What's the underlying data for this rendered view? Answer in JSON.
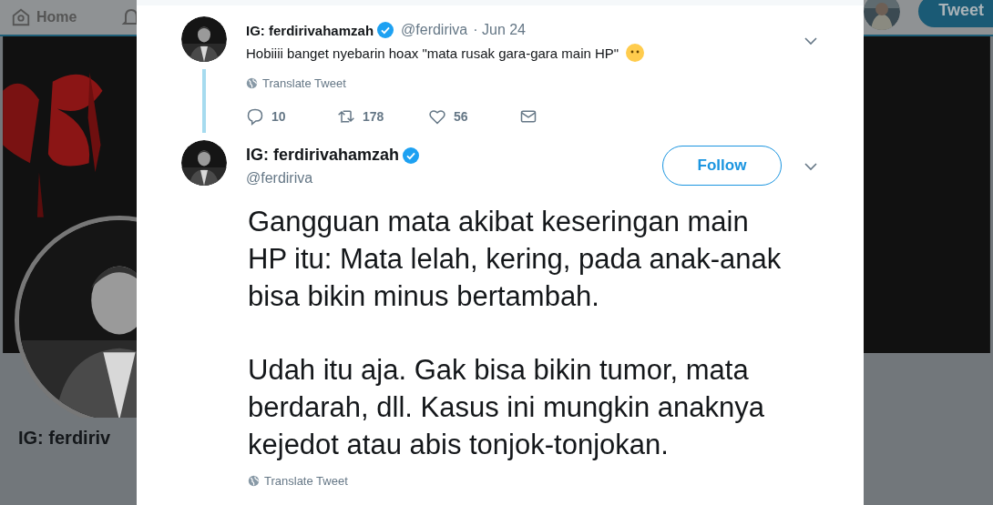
{
  "background_page": {
    "nav": {
      "home_label": "Home",
      "tweet_button": "Tweet"
    },
    "profile_name": "IG: ferdiriv"
  },
  "thread_tweet": {
    "name": "IG: ferdirivahamzah",
    "verified": true,
    "handle": "@ferdiriva",
    "date": "· Jun 24",
    "text": "Hobiiii banget nyebarin hoax \"mata rusak gara-gara main HP\"",
    "translate": "Translate Tweet",
    "replies": "10",
    "retweets": "178",
    "likes": "56"
  },
  "focused_tweet": {
    "name": "IG: ferdirivahamzah",
    "verified": true,
    "handle": "@ferdiriva",
    "follow_button": "Follow",
    "paragraphs": [
      "Gangguan mata akibat keseringan main HP itu: Mata lelah, kering, pada anak-anak bisa bikin minus bertambah.",
      "Udah itu aja. Gak bisa bikin tumor, mata berdarah, dll. Kasus ini mungkin anaknya kejedot atau abis tonjok-tonjokan."
    ],
    "translate": "Translate Tweet"
  }
}
